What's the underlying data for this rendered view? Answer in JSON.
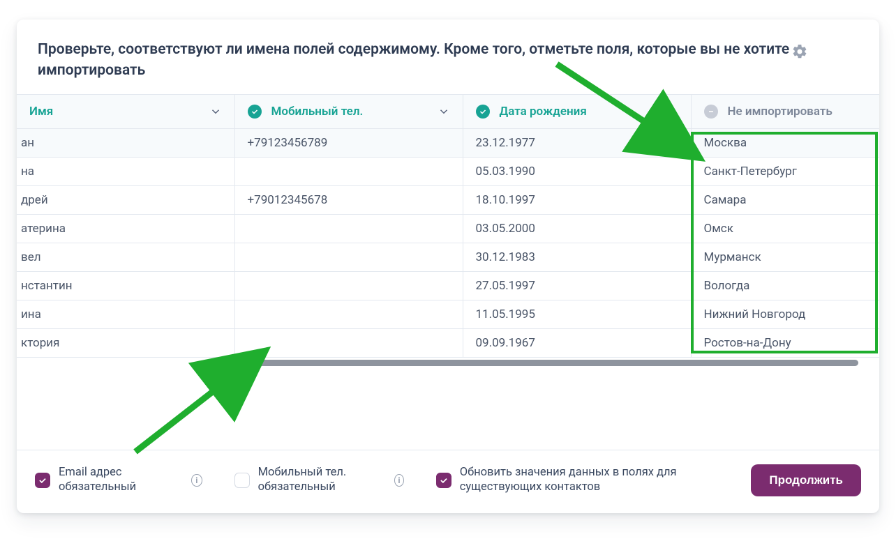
{
  "header": {
    "title": "Проверьте, соответствуют ли имена полей содержимому. Кроме того, отметьте поля, которые вы не хотите импортировать"
  },
  "columns": [
    {
      "label": "Имя",
      "status": "active",
      "has_icon": false
    },
    {
      "label": "Мобильный тел.",
      "status": "active",
      "has_icon": true
    },
    {
      "label": "Дата рождения",
      "status": "active",
      "has_icon": true
    },
    {
      "label": "Не импортировать",
      "status": "disabled",
      "has_icon": true
    }
  ],
  "rows": [
    {
      "name": "ан",
      "phone": "+79123456789",
      "dob": "23.12.1977",
      "city": "Москва"
    },
    {
      "name": "на",
      "phone": "",
      "dob": "05.03.1990",
      "city": "Санкт-Петербург"
    },
    {
      "name": "дрей",
      "phone": "+79012345678",
      "dob": "18.10.1997",
      "city": "Самара"
    },
    {
      "name": "атерина",
      "phone": "",
      "dob": "03.05.2000",
      "city": "Омск"
    },
    {
      "name": "вел",
      "phone": "",
      "dob": "30.12.1983",
      "city": "Мурманск"
    },
    {
      "name": "нстантин",
      "phone": "",
      "dob": "27.05.1997",
      "city": "Вологда"
    },
    {
      "name": "ина",
      "phone": "",
      "dob": "11.05.1995",
      "city": "Нижний Новгород"
    },
    {
      "name": "ктория",
      "phone": "",
      "dob": "09.09.1967",
      "city": "Ростов-на-Дону"
    }
  ],
  "footer": {
    "opt_email": "Email адрес обязательный",
    "opt_phone": "Мобильный тел. обязательный",
    "opt_update": "Обновить значения данных в полях для существующих контактов",
    "continue": "Продолжить"
  },
  "colors": {
    "accent": "#17A394",
    "brand": "#7B2C6F",
    "annotation": "#1FAE2E"
  }
}
